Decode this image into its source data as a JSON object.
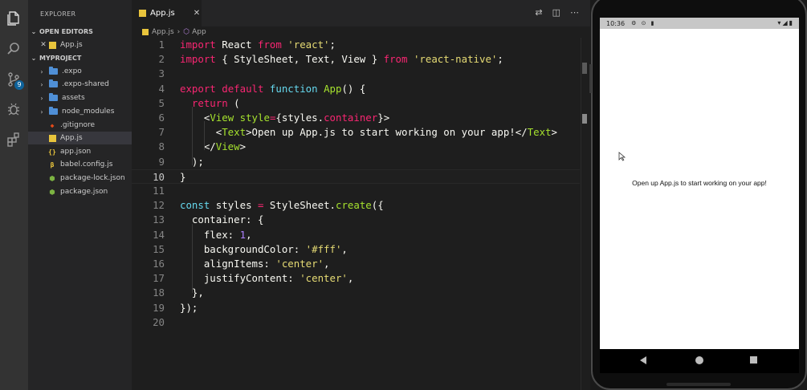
{
  "sidebar": {
    "title": "EXPLORER",
    "open_editors_label": "OPEN EDITORS",
    "open_editor_file": "App.js",
    "project_label": "MYPROJECT",
    "items": [
      {
        "label": ".expo",
        "kind": "folder"
      },
      {
        "label": ".expo-shared",
        "kind": "folder"
      },
      {
        "label": "assets",
        "kind": "folder"
      },
      {
        "label": "node_modules",
        "kind": "folder"
      },
      {
        "label": ".gitignore",
        "kind": "git"
      },
      {
        "label": "App.js",
        "kind": "js"
      },
      {
        "label": "app.json",
        "kind": "json"
      },
      {
        "label": "babel.config.js",
        "kind": "babel"
      },
      {
        "label": "package-lock.json",
        "kind": "npm"
      },
      {
        "label": "package.json",
        "kind": "npm"
      }
    ]
  },
  "activity": {
    "scm_badge": "9",
    "icons": [
      "files-icon",
      "search-icon",
      "source-control-icon",
      "debug-icon",
      "extensions-icon"
    ]
  },
  "editor": {
    "tab_label": "App.js",
    "breadcrumb_file": "App.js",
    "breadcrumb_symbol": "App",
    "line_numbers": [
      "1",
      "2",
      "3",
      "4",
      "5",
      "6",
      "7",
      "8",
      "9",
      "10",
      "11",
      "12",
      "13",
      "14",
      "15",
      "16",
      "17",
      "18",
      "19",
      "20"
    ],
    "current_line": "10"
  },
  "phone": {
    "time": "10:36",
    "app_text": "Open up App.js to start working on your app!"
  },
  "colors": {
    "keyword": "#f92672",
    "string": "#e6db74",
    "function": "#a6e22e",
    "number": "#ae81ff",
    "accent": "#0e639c"
  }
}
